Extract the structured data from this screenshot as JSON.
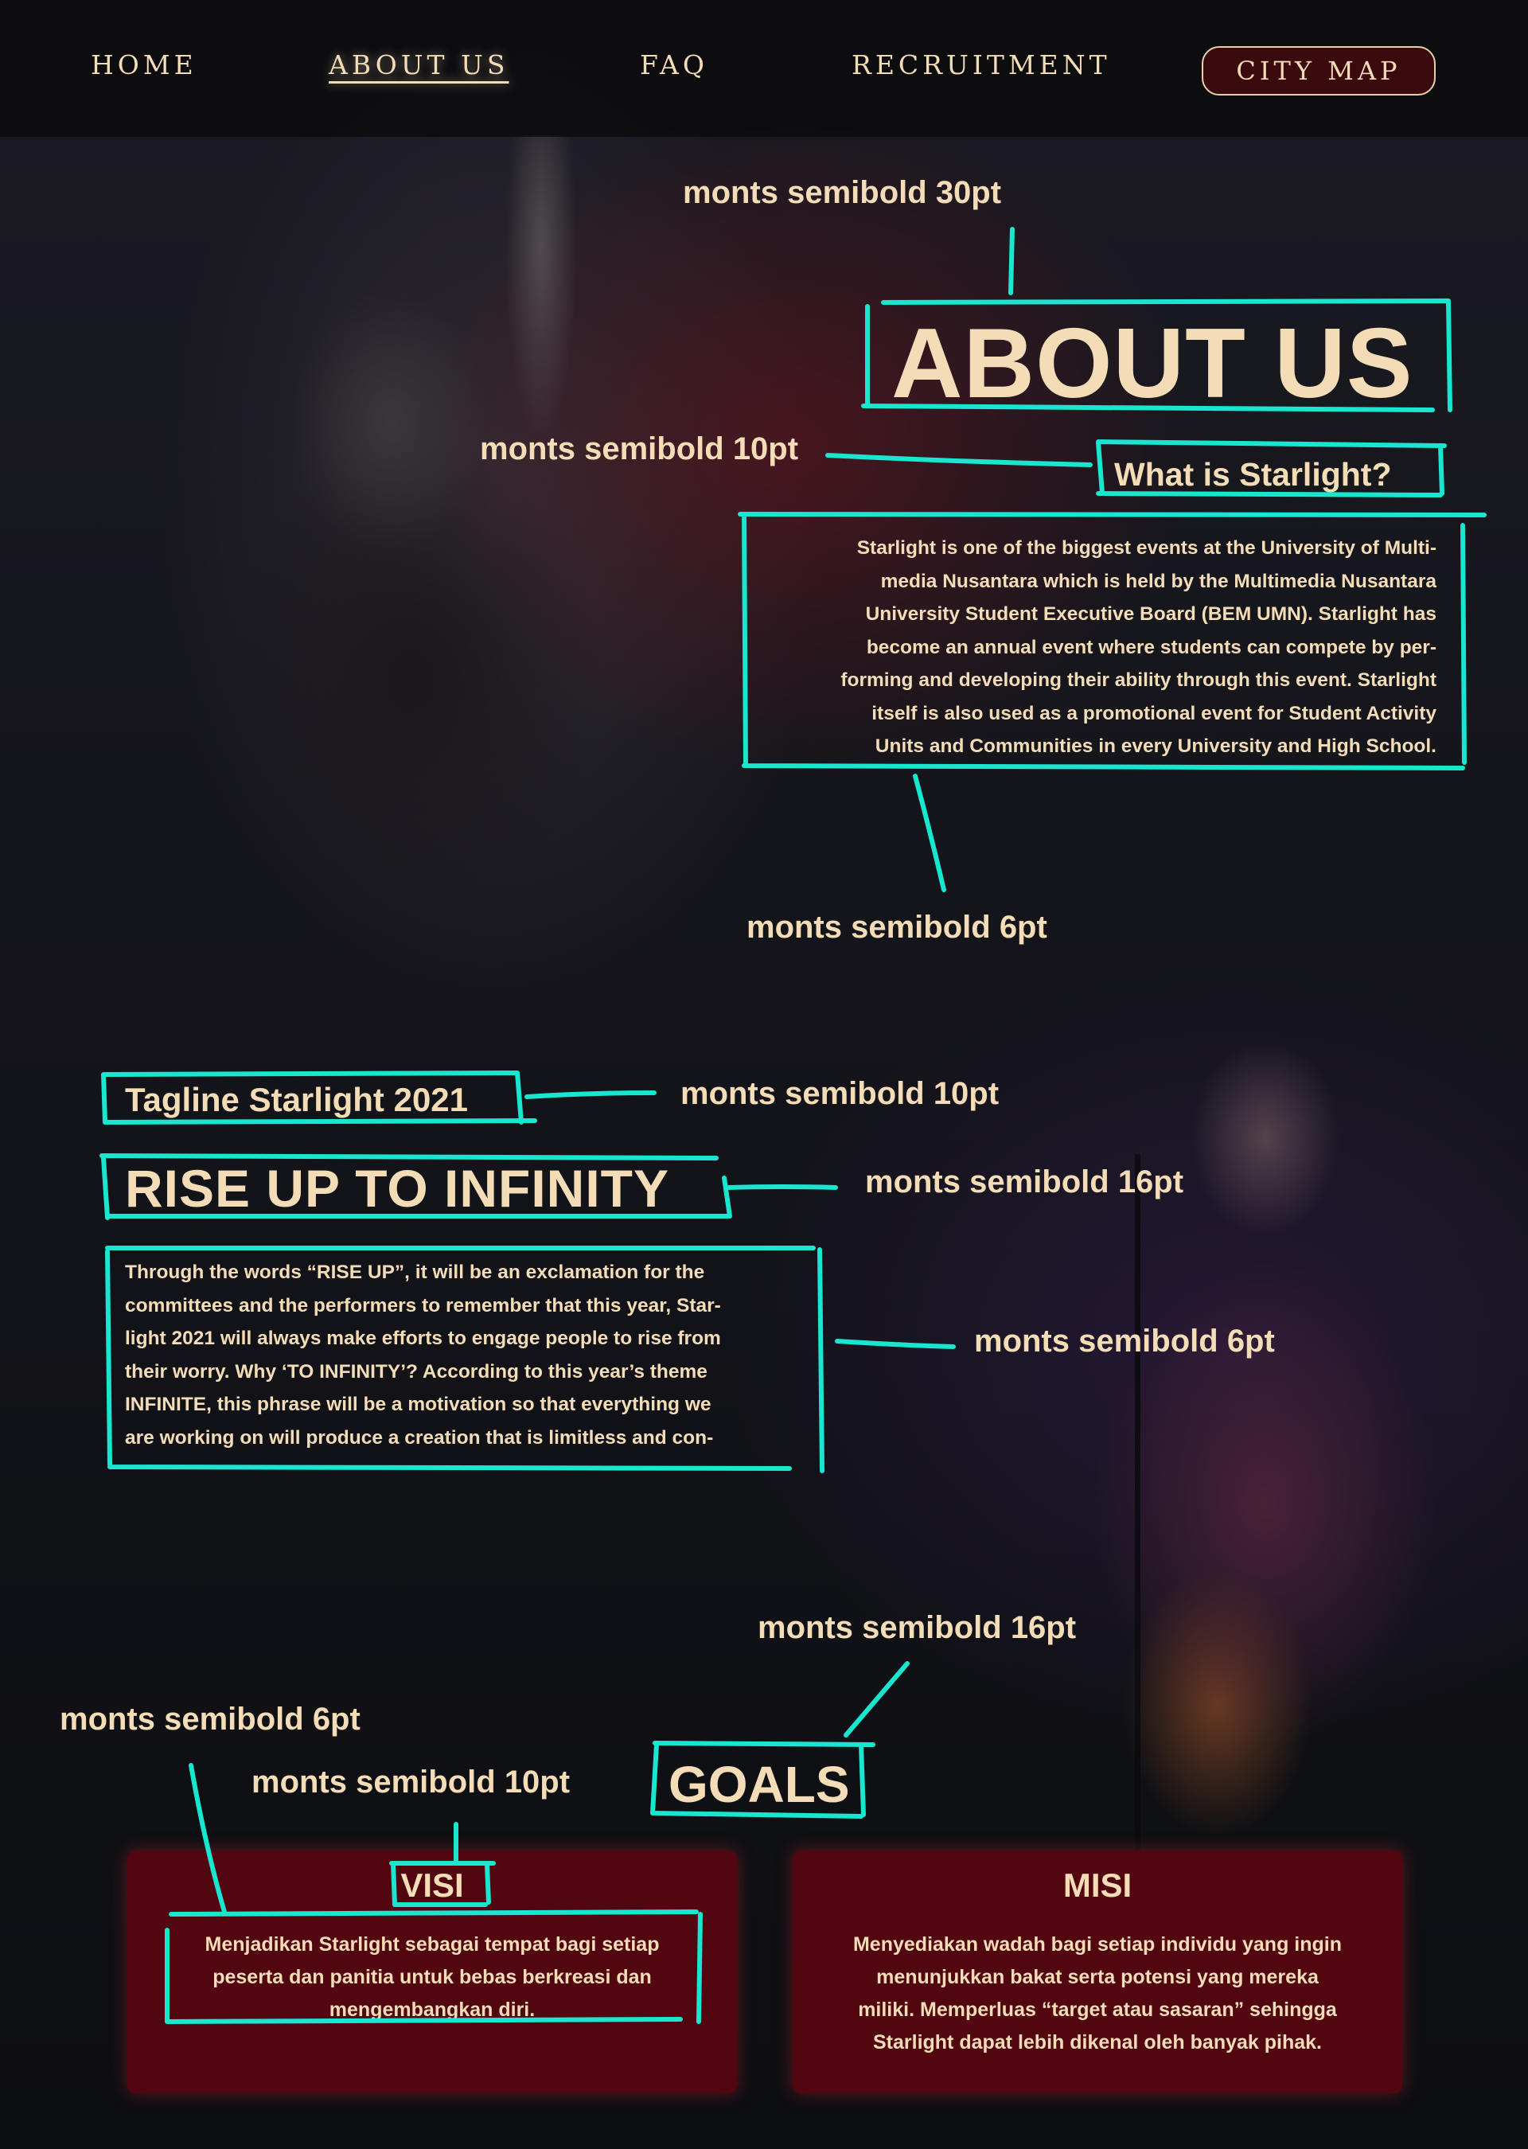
{
  "nav": {
    "items": [
      {
        "label": "HOME"
      },
      {
        "label": "ABOUT US"
      },
      {
        "label": "FAQ"
      },
      {
        "label": "RECRUITMENT"
      }
    ],
    "cta_label": "CITY MAP"
  },
  "annotations": {
    "about_title": "monts semibold 30pt",
    "what_is": "monts semibold 10pt",
    "about_body": "monts semibold 6pt",
    "tagline": "monts semibold 10pt",
    "rise_title": "monts semibold 16pt",
    "rise_body": "monts semibold 6pt",
    "goals_title": "monts semibold 16pt",
    "visi_body": "monts semibold 6pt",
    "visi_title": "monts semibold 10pt"
  },
  "about": {
    "title": "ABOUT US",
    "subtitle": "What is Starlight?",
    "body_lines": [
      "Starlight is one of the biggest events at the University of Multi-",
      "media Nusantara  which is held by the Multimedia Nusantara",
      "University Student Executive Board (BEM UMN). Starlight has",
      "become an annual event where students can compete by per-",
      "forming and developing their ability through this event. Starlight",
      "itself is also used as a promotional event for Student Activity",
      "Units and Communities in every University and High School."
    ]
  },
  "tagline": {
    "label": "Tagline Starlight 2021",
    "title": "RISE UP TO INFINITY",
    "body_lines": [
      "Through the words “RISE UP”, it will be an exclamation for the",
      "committees and the performers to remember that this year, Star-",
      "light 2021 will always make efforts to engage people to rise from",
      "their worry. Why ‘TO INFINITY’? According to this year’s theme",
      "INFINITE, this phrase will be a motivation so that everything we",
      "are working on will produce a creation that is limitless and con-"
    ]
  },
  "goals": {
    "title": "GOALS",
    "visi": {
      "title": "VISI",
      "body_lines": [
        "Menjadikan Starlight sebagai tempat bagi setiap",
        "peserta dan panitia untuk bebas berkreasi dan",
        "mengembangkan diri."
      ]
    },
    "misi": {
      "title": "MISI",
      "body_lines": [
        "Menyediakan wadah bagi setiap individu yang ingin",
        "menunjukkan bakat serta potensi yang mereka",
        "miliki. Memperluas “target atau sasaran” sehingga",
        "Starlight dapat lebih dikenal oleh banyak pihak."
      ]
    }
  },
  "colors": {
    "text": "#f3dcb6",
    "markup": "#19e6cf",
    "card": "#510610",
    "nav_bg": "#0b0b0d"
  }
}
